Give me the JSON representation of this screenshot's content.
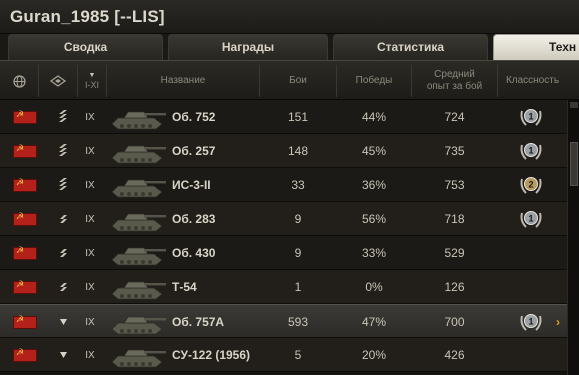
{
  "title": "Guran_1985 [--LIS]",
  "tabs": [
    "Сводка",
    "Награды",
    "Статистика",
    "Техн"
  ],
  "headers": {
    "name": "Название",
    "battles": "Бои",
    "wins": "Победы",
    "avg_xp_line1": "Средний",
    "avg_xp_line2": "опыт за бой",
    "mastery": "Классность",
    "tier_sort": "I-XI"
  },
  "rows": [
    {
      "tier": "IX",
      "name": "Об. 752",
      "battles": "151",
      "wins": "44%",
      "xp": "724",
      "mastery": "1",
      "sel": false,
      "chev": ""
    },
    {
      "tier": "IX",
      "name": "Об. 257",
      "battles": "148",
      "wins": "45%",
      "xp": "735",
      "mastery": "1",
      "sel": false,
      "chev": ""
    },
    {
      "tier": "IX",
      "name": "ИС-3-II",
      "battles": "33",
      "wins": "36%",
      "xp": "753",
      "mastery": "2",
      "sel": false,
      "chev": ""
    },
    {
      "tier": "IX",
      "name": "Об. 283",
      "battles": "9",
      "wins": "56%",
      "xp": "718",
      "mastery": "1",
      "sel": false,
      "chev": ""
    },
    {
      "tier": "IX",
      "name": "Об. 430",
      "battles": "9",
      "wins": "33%",
      "xp": "529",
      "mastery": "",
      "sel": false,
      "chev": ""
    },
    {
      "tier": "IX",
      "name": "Т-54",
      "battles": "1",
      "wins": "0%",
      "xp": "126",
      "mastery": "",
      "sel": false,
      "chev": ""
    },
    {
      "tier": "IX",
      "name": "Об. 757А",
      "battles": "593",
      "wins": "47%",
      "xp": "700",
      "mastery": "1",
      "sel": true,
      "chev": "›"
    },
    {
      "tier": "IX",
      "name": "СУ-122 (1956)",
      "battles": "5",
      "wins": "20%",
      "xp": "426",
      "mastery": "",
      "sel": false,
      "chev": ""
    }
  ],
  "class_icons": [
    "heavy-tank-icon",
    "heavy-tank-icon",
    "heavy-tank-icon",
    "medium-tank-icon",
    "medium-tank-icon",
    "medium-tank-icon",
    "light-tank-icon",
    "td-icon"
  ],
  "colors": {
    "accent": "#e0a11e",
    "flag": "#b3211a"
  }
}
